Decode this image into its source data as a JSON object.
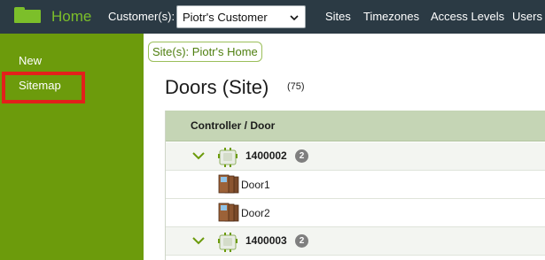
{
  "topbar": {
    "home_label": "Home",
    "customer_label": "Customer(s):",
    "customer_value": "Piotr's Customer",
    "nav": [
      "Sites",
      "Timezones",
      "Access Levels",
      "Users"
    ]
  },
  "sidebar": {
    "items": [
      {
        "label": "New"
      },
      {
        "label": "Sitemap"
      }
    ]
  },
  "breadcrumb": "Site(s):  Piotr's Home",
  "page": {
    "title": "Doors (Site)",
    "count": "(75)"
  },
  "table": {
    "header": "Controller / Door",
    "rows": [
      {
        "type": "controller",
        "name": "1400002",
        "badge": "2"
      },
      {
        "type": "door",
        "name": "Door1"
      },
      {
        "type": "door",
        "name": "Door2"
      },
      {
        "type": "controller",
        "name": "1400003",
        "badge": "2"
      }
    ]
  },
  "colors": {
    "topbar_bg": "#2b3a44",
    "accent_green": "#7cbf2a",
    "sidebar_bg": "#6c9b0c",
    "header_bg": "#c5d5b5",
    "highlight_red": "#e3201b"
  }
}
